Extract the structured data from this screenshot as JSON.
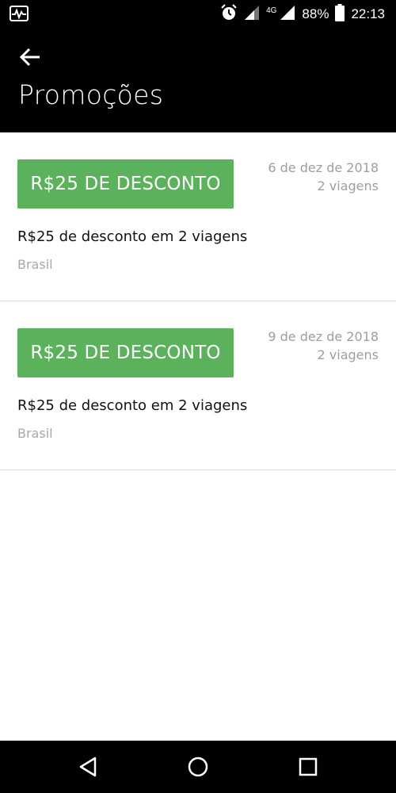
{
  "status_bar": {
    "network": "4G",
    "battery": "88%",
    "time": "22:13"
  },
  "app_bar": {
    "title": "Promoções"
  },
  "promotions": [
    {
      "badge": "R$25 DE DESCONTO",
      "date": "6 de dez de 2018",
      "trips": "2 viagens",
      "description": "R$25 de desconto em 2 viagens",
      "region": "Brasil"
    },
    {
      "badge": "R$25 DE DESCONTO",
      "date": "9 de dez de 2018",
      "trips": "2 viagens",
      "description": "R$25 de desconto em 2 viagens",
      "region": "Brasil"
    }
  ],
  "colors": {
    "badge_green": "#5cb15c",
    "header_bg": "#000000",
    "muted_text": "#9e9e9e"
  },
  "icons": {
    "status_left": "activity-monitor-icon",
    "alarm": "alarm-clock-icon",
    "back": "arrow-left-icon",
    "nav_back": "triangle-back-icon",
    "nav_home": "circle-home-icon",
    "nav_recents": "square-recents-icon"
  }
}
